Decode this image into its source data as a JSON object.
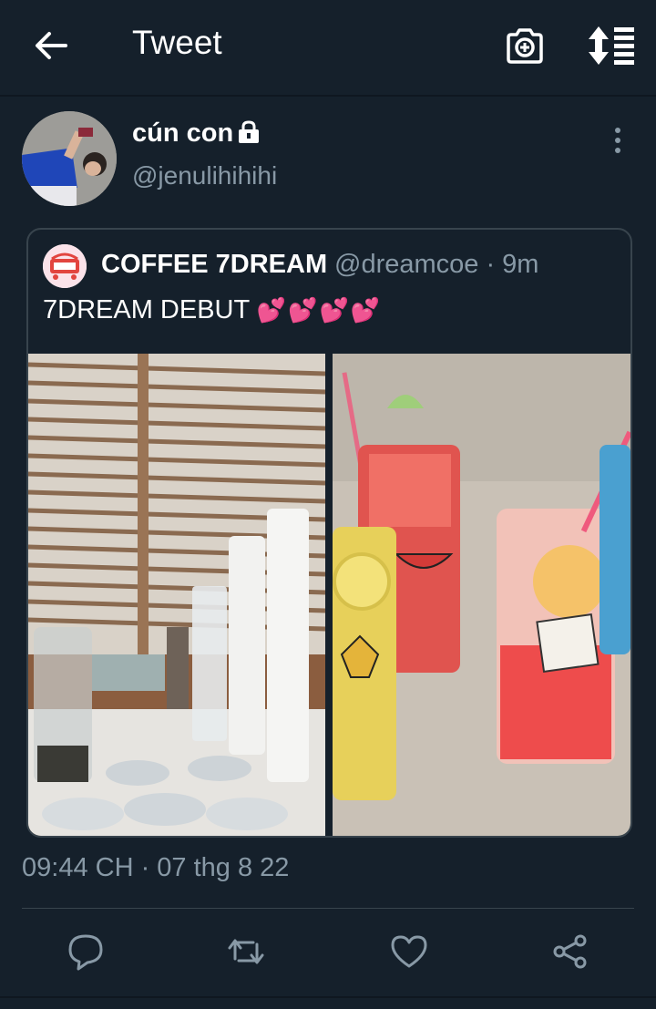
{
  "header": {
    "title": "Tweet",
    "back_icon": "arrow-left-icon",
    "camera_icon": "camera-plus-icon",
    "sort_icon": "sort-list-icon"
  },
  "author": {
    "name": "cún con",
    "handle": "@jenulihihihi",
    "protected_icon": "lock-icon",
    "more_icon": "vertical-dots-icon"
  },
  "quote": {
    "name": "COFFEE 7DREAM",
    "handle": "@dreamcoe · 9m",
    "text": "7DREAM DEBUT",
    "emoji": "💕💕💕💕"
  },
  "timestamp": "09:44 CH · 07 thg 8 22",
  "actions": {
    "reply_icon": "reply-bubble-icon",
    "retweet_icon": "retweet-icon",
    "like_icon": "heart-icon",
    "share_icon": "share-icon"
  },
  "colors": {
    "background": "#15202b",
    "secondary_text": "#8899a6",
    "border": "#38444d"
  }
}
